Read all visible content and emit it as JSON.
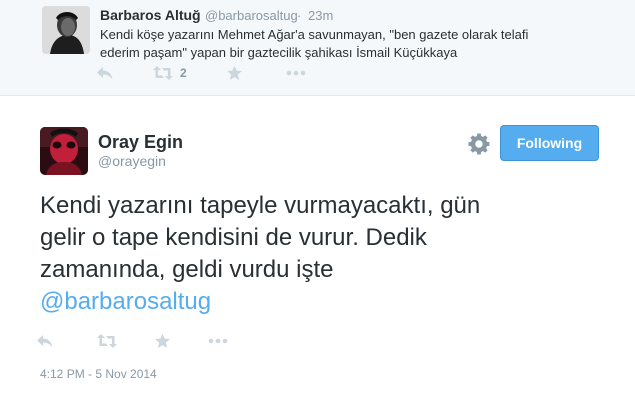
{
  "context_tweet": {
    "author_name": "Barbaros Altuğ",
    "author_handle": "@barbarosaltug",
    "separator": "·",
    "time": "23m",
    "text_line1": "Kendi köşe yazarını Mehmet Ağar'a savunmayan, \"ben gazete olarak telafi",
    "text_line2": "ederim paşam\" yapan bir gaztecilik şahikası İsmail Küçükkaya",
    "retweet_count": "2",
    "icons": [
      "reply-icon",
      "retweet-icon",
      "favorite-icon",
      "more-icon"
    ]
  },
  "main_tweet": {
    "author_name": "Oray Egin",
    "author_handle": "@orayegin",
    "follow_label": "Following",
    "text_line1": "Kendi yazarını tapeyle vurmayacaktı, gün",
    "text_line2": "gelir o tape kendisini de vurur. Dedik",
    "text_line3": "zamanında, geldi vurdu işte",
    "mention": "@barbarosaltug",
    "timestamp": "4:12 PM - 5 Nov 2014",
    "icons": [
      "reply-icon",
      "retweet-icon",
      "favorite-icon",
      "more-icon",
      "gear-icon"
    ]
  },
  "colors": {
    "accent": "#55acee",
    "text": "#292f33",
    "muted": "#8899a6",
    "icon": "#ccd6dd",
    "context_bg": "#f5f8fa"
  }
}
